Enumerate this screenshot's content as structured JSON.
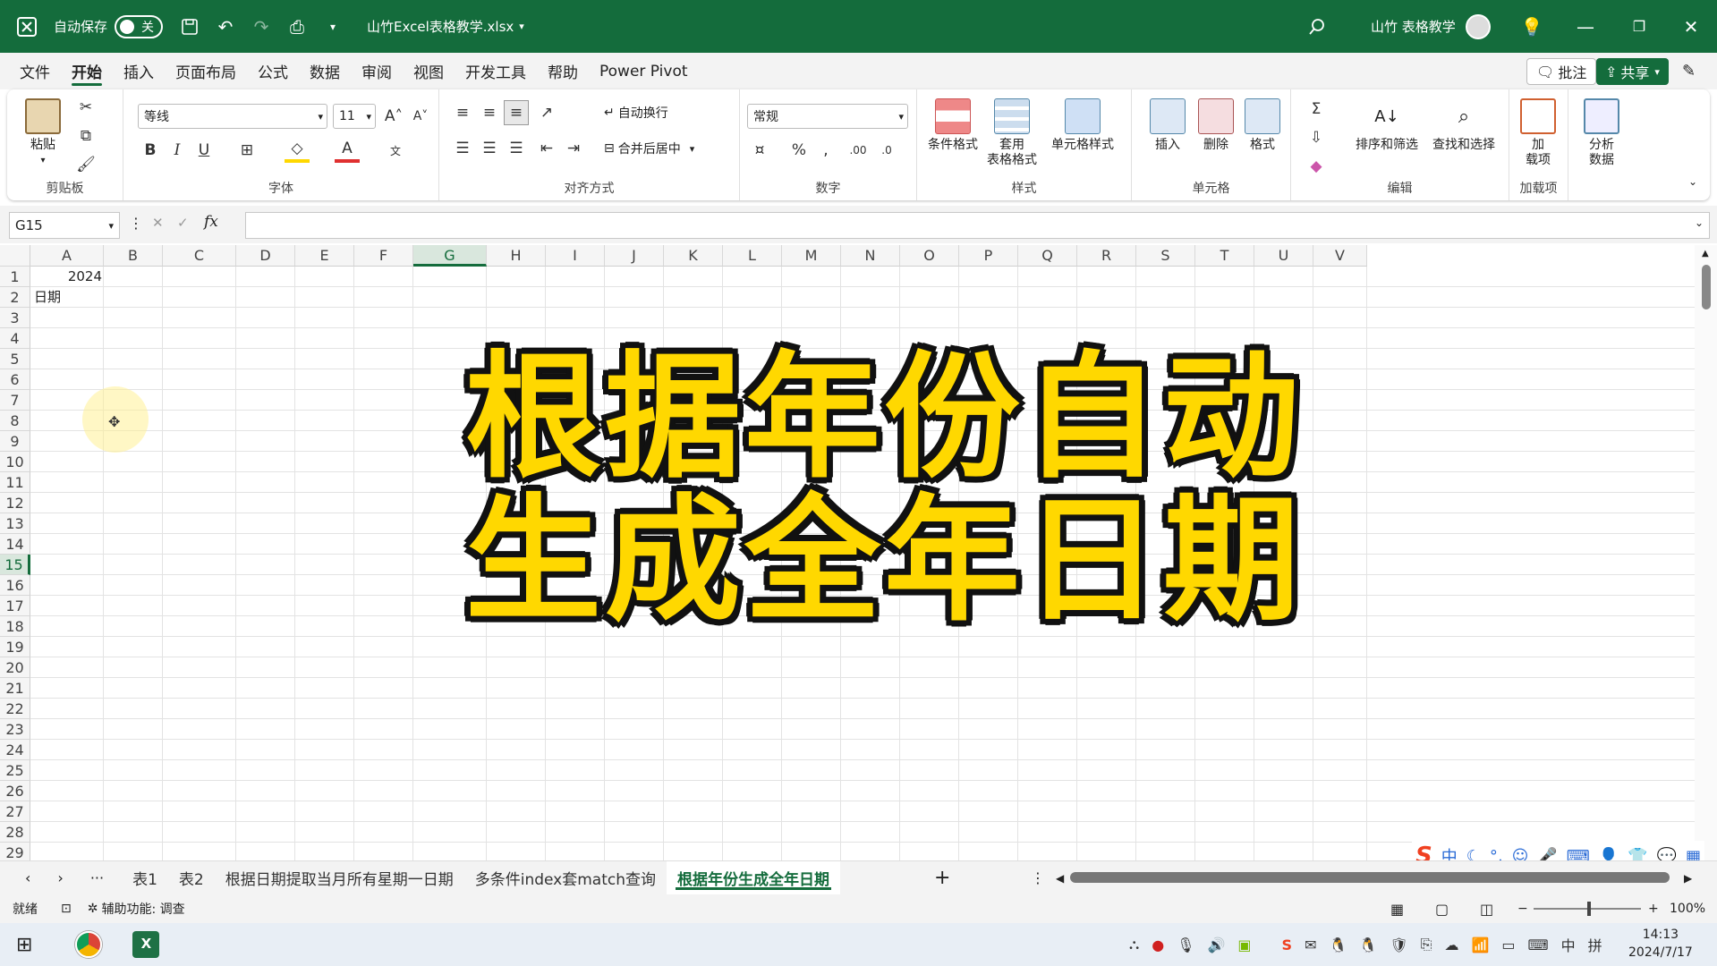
{
  "titlebar": {
    "autosave_label": "自动保存",
    "autosave_state": "关",
    "filename": "山竹Excel表格教学.xlsx",
    "user": "山竹 表格教学",
    "bg_color": "#146c3c"
  },
  "menu": {
    "items": [
      "文件",
      "开始",
      "插入",
      "页面布局",
      "公式",
      "数据",
      "审阅",
      "视图",
      "开发工具",
      "帮助",
      "Power Pivot"
    ],
    "active": "开始",
    "comment_label": "批注",
    "share_label": "共享"
  },
  "ribbon": {
    "clipboard": {
      "paste": "粘贴",
      "label": "剪贴板"
    },
    "font": {
      "name": "等线",
      "size": "11",
      "label": "字体",
      "bold": "B",
      "italic": "I",
      "underline": "U"
    },
    "align": {
      "wrap": "自动换行",
      "merge": "合并后居中",
      "label": "对齐方式"
    },
    "number": {
      "format": "常规",
      "label": "数字"
    },
    "styles": {
      "cond": "条件格式",
      "table_l1": "套用",
      "table_l2": "表格格式",
      "cell": "单元格样式",
      "label": "样式"
    },
    "cells": {
      "insert": "插入",
      "delete": "删除",
      "format": "格式",
      "label": "单元格"
    },
    "edit": {
      "sort": "排序和筛选",
      "find": "查找和选择",
      "label": "编辑"
    },
    "addins": {
      "l1": "加",
      "l2": "载项",
      "label": "加载项"
    },
    "analyze": {
      "l1": "分析",
      "l2": "数据"
    }
  },
  "formula_bar": {
    "namebox": "G15",
    "fx": "fx",
    "content": ""
  },
  "sheet": {
    "columns": [
      "A",
      "B",
      "C",
      "D",
      "E",
      "F",
      "G",
      "H",
      "I",
      "J",
      "K",
      "L",
      "M",
      "N",
      "O",
      "P",
      "Q",
      "R",
      "S",
      "T",
      "U",
      "V"
    ],
    "selected_col": "G",
    "selected_row": 15,
    "rows": [
      "1",
      "2",
      "3",
      "4",
      "5",
      "6",
      "7",
      "8",
      "9",
      "10",
      "11",
      "12",
      "13",
      "14",
      "15",
      "16",
      "17",
      "18",
      "19",
      "20",
      "21",
      "22",
      "23",
      "24",
      "25",
      "26",
      "27",
      "28",
      "29"
    ],
    "cells": {
      "A1": "2024",
      "A2": "日期"
    }
  },
  "overlay": {
    "line1": "根据年份自动",
    "line2": "生成全年日期",
    "color": "#ffd800"
  },
  "tabs": {
    "items": [
      "表1",
      "表2",
      "根据日期提取当月所有星期一日期",
      "多条件index套match查询",
      "根据年份生成全年日期"
    ],
    "active": "根据年份生成全年日期",
    "add": "+"
  },
  "status": {
    "ready": "就绪",
    "accessibility": "辅助功能: 调查",
    "zoom": "100%"
  },
  "ime": {
    "lang": "中"
  },
  "taskbar": {
    "time": "14:13",
    "date": "2024/7/17",
    "lang": "中",
    "input": "拼"
  }
}
